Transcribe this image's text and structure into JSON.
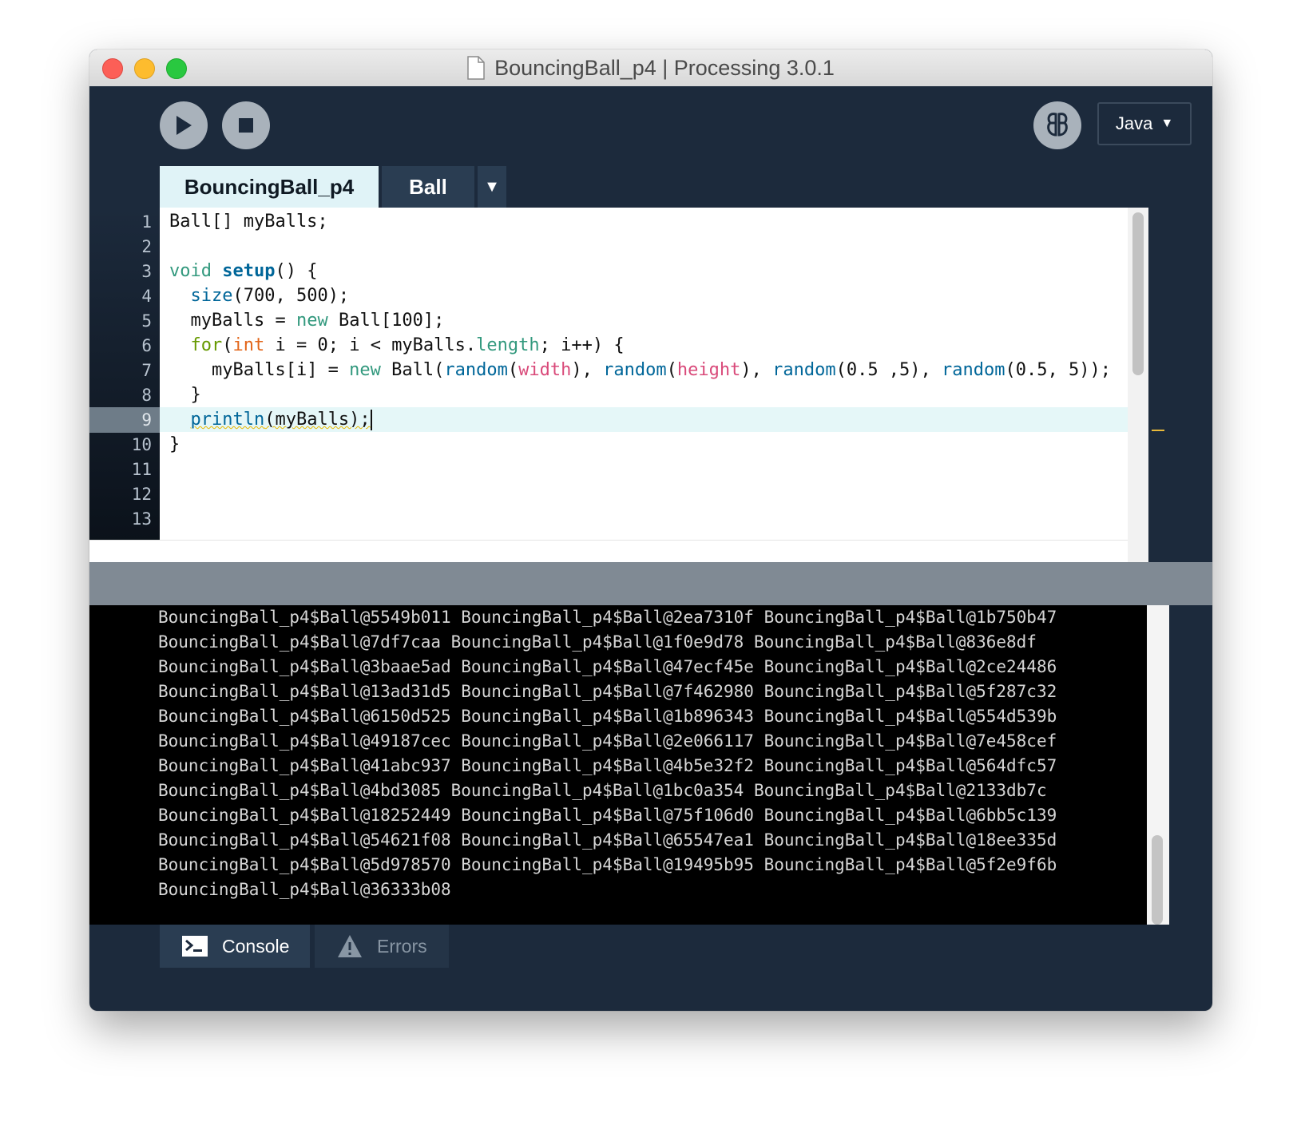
{
  "window": {
    "title": "BouncingBall_p4 | Processing 3.0.1"
  },
  "toolbar": {
    "run_icon": "play-icon",
    "stop_icon": "stop-icon",
    "debug_icon": "debugger-butterfly-icon",
    "mode": "Java",
    "mode_arrow": "▼"
  },
  "tabs": [
    {
      "label": "BouncingBall_p4",
      "active": true
    },
    {
      "label": "Ball",
      "active": false
    }
  ],
  "tab_menu": "▼",
  "editor": {
    "line_numbers": [
      "1",
      "2",
      "3",
      "4",
      "5",
      "6",
      "7",
      "8",
      "9",
      "10",
      "11",
      "12",
      "13"
    ],
    "current_line": 9,
    "code": {
      "l1": "Ball[] myBalls;",
      "l3_void": "void",
      "l3_setup": "setup",
      "l3_rest": "() {",
      "l4_size": "size",
      "l4_rest": "(700, 500);",
      "l5_a": "myBalls = ",
      "l5_new": "new",
      "l5_b": " Ball[100];",
      "l6_for": "for",
      "l6_paren": "(",
      "l6_int": "int",
      "l6_a": " i = 0; i < myBalls.",
      "l6_length": "length",
      "l6_b": "; i++) {",
      "l7_a": "myBalls[i] = ",
      "l7_new": "new",
      "l7_b": " Ball(",
      "l7_r1": "random",
      "l7_p1": "(",
      "l7_width": "width",
      "l7_c": "), ",
      "l7_r2": "random",
      "l7_p2": "(",
      "l7_height": "height",
      "l7_d": "), ",
      "l7_r3": "random",
      "l7_e": "(0.5 ,5), ",
      "l7_r4": "random",
      "l7_f": "(0.5, 5));",
      "l8": "}",
      "l9_println": "println",
      "l9_rest": "(myBalls);",
      "l10": "}"
    }
  },
  "console": {
    "lines": [
      "BouncingBall_p4$Ball@5549b011 BouncingBall_p4$Ball@2ea7310f BouncingBall_p4$Ball@1b750b47",
      "BouncingBall_p4$Ball@7df7caa BouncingBall_p4$Ball@1f0e9d78 BouncingBall_p4$Ball@836e8df",
      "BouncingBall_p4$Ball@3baae5ad BouncingBall_p4$Ball@47ecf45e BouncingBall_p4$Ball@2ce24486",
      "BouncingBall_p4$Ball@13ad31d5 BouncingBall_p4$Ball@7f462980 BouncingBall_p4$Ball@5f287c32",
      "BouncingBall_p4$Ball@6150d525 BouncingBall_p4$Ball@1b896343 BouncingBall_p4$Ball@554d539b",
      "BouncingBall_p4$Ball@49187cec BouncingBall_p4$Ball@2e066117 BouncingBall_p4$Ball@7e458cef",
      "BouncingBall_p4$Ball@41abc937 BouncingBall_p4$Ball@4b5e32f2 BouncingBall_p4$Ball@564dfc57",
      "BouncingBall_p4$Ball@4bd3085 BouncingBall_p4$Ball@1bc0a354 BouncingBall_p4$Ball@2133db7c",
      "BouncingBall_p4$Ball@18252449 BouncingBall_p4$Ball@75f106d0 BouncingBall_p4$Ball@6bb5c139",
      "BouncingBall_p4$Ball@54621f08 BouncingBall_p4$Ball@65547ea1 BouncingBall_p4$Ball@18ee335d",
      "BouncingBall_p4$Ball@5d978570 BouncingBall_p4$Ball@19495b95 BouncingBall_p4$Ball@5f2e9f6b",
      "BouncingBall_p4$Ball@36333b08"
    ]
  },
  "footer": {
    "console_label": "Console",
    "console_icon": "terminal-icon",
    "errors_label": "Errors",
    "errors_icon": "warning-icon"
  },
  "colors": {
    "toolbar_bg": "#1c2a3c",
    "active_tab_bg": "#e0f3f7",
    "current_line_bg": "#e5f7f8",
    "console_bg": "#000000",
    "keyword_teal": "#33997e",
    "function_blue": "#006699",
    "for_green": "#669900",
    "int_orange": "#e2661a",
    "variable_pink": "#d94a7a",
    "warning_underline": "#e6b800"
  }
}
